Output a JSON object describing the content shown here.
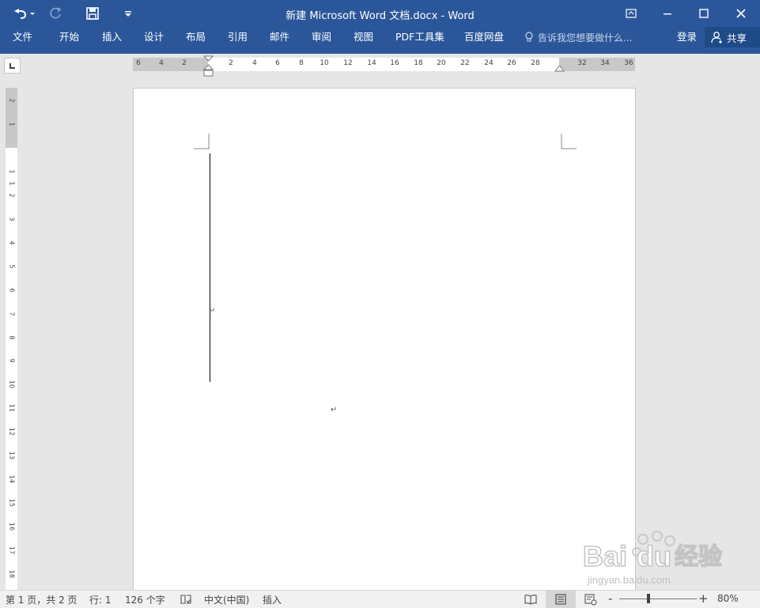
{
  "window": {
    "title": "新建 Microsoft Word 文档.docx - Word"
  },
  "quick_access": {
    "undo_icon": "undo-icon",
    "redo_icon": "redo-icon",
    "save_icon": "save-icon",
    "customize_icon": "customize-qat-icon"
  },
  "window_controls": {
    "ribbon_display_icon": "ribbon-display-options-icon",
    "minimize_icon": "minimize-icon",
    "maximize_icon": "maximize-icon",
    "close_icon": "close-icon"
  },
  "ribbon": {
    "tabs": [
      {
        "label": "文件"
      },
      {
        "label": "开始"
      },
      {
        "label": "插入"
      },
      {
        "label": "设计"
      },
      {
        "label": "布局"
      },
      {
        "label": "引用"
      },
      {
        "label": "邮件"
      },
      {
        "label": "审阅"
      },
      {
        "label": "视图"
      },
      {
        "label": "PDF工具集"
      },
      {
        "label": "百度网盘"
      }
    ],
    "tell_me": "告诉我您想要做什么...",
    "login": "登录",
    "share": "共享"
  },
  "ruler": {
    "horizontal_labels": [
      "6",
      "4",
      "2",
      "2",
      "4",
      "6",
      "8",
      "10",
      "12",
      "14",
      "16",
      "18",
      "20",
      "22",
      "24",
      "26",
      "28",
      "32",
      "34",
      "36"
    ],
    "vertical_labels": [
      "2",
      "1",
      "1",
      "1",
      "2",
      "3",
      "4",
      "5",
      "6",
      "7",
      "8",
      "9",
      "10",
      "11",
      "12",
      "13",
      "14",
      "15",
      "16",
      "17",
      "18"
    ]
  },
  "document": {
    "paragraph_mark": "↵"
  },
  "status_bar": {
    "page": "第 1 页，共 2 页",
    "line": "行: 1",
    "words": "126 个字",
    "language": "中文(中国)",
    "mode": "插入",
    "zoom": "80%",
    "zoom_level_percent": 80,
    "zoom_minus": "-",
    "zoom_plus": "+"
  },
  "watermark": {
    "logo_text": "Bai du 经验",
    "url": "jingyan.baidu.com"
  }
}
